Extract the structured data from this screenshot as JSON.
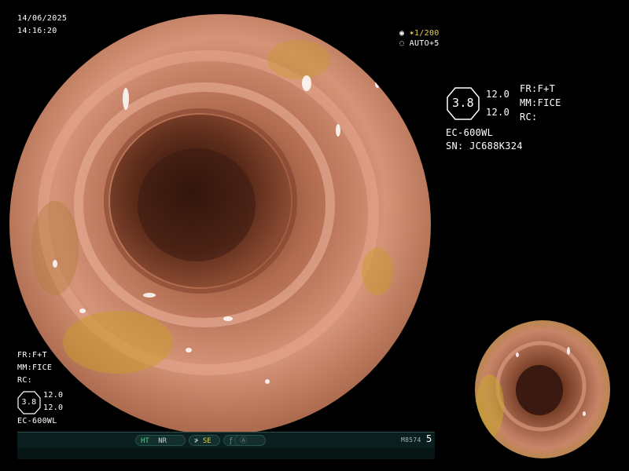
{
  "overlay": {
    "date": "14/06/2025",
    "time": "14:16:20",
    "shutter": "1/200",
    "auto_gain": "AUTO+5",
    "right_info": {
      "hex_value": "3.8",
      "val_a": "12.0",
      "val_b": "12.0",
      "fr": "FR:F+T",
      "mm": "MM:FICE",
      "rc": "RC:",
      "scope_model": "EC-600WL",
      "serial": "SN: JC688K324"
    },
    "left_info": {
      "fr": "FR:F+T",
      "mm": "MM:FICE",
      "rc": "RC:",
      "hex_value": "3.8",
      "val_a": "12.0",
      "val_b": "12.0",
      "scope_model": "EC-600WL"
    }
  },
  "status_bar": {
    "ht": "HT",
    "nr": "NR",
    "se": "SE",
    "code": "M8574",
    "number": "5"
  },
  "colors": {
    "tissue": "#c8866a",
    "lumen": "#3a1a10",
    "bile": "#c99a2e",
    "indicator_green": "#3ddc7a",
    "indicator_yellow": "#e6d34a"
  }
}
